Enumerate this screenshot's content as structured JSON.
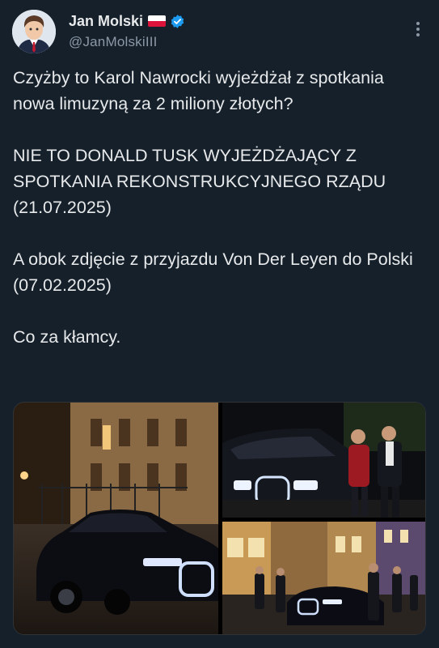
{
  "author": {
    "display_name": "Jan Molski",
    "handle": "@JanMolskiIII",
    "flag_icon": "poland-flag-icon",
    "verified_icon": "verified-badge-icon",
    "badge_color": "#1d9bf0"
  },
  "tweet": {
    "paragraphs": [
      "Czyżby to Karol Nawrocki wyjeżdżał z spotkania nowa limuzyną za 2 miliony złotych?",
      "NIE TO DONALD TUSK WYJEŻDŻAJĄCY Z SPOTKANIA REKONSTRUKCYJNEGO RZĄDU (21.07.2025)",
      "A obok zdjęcie z przyjazdu Von Der Leyen do Polski (07.02.2025)",
      "Co za kłamcy."
    ]
  },
  "colors": {
    "background": "#15202b",
    "text": "#e7e9ea",
    "secondary": "#8b98a5"
  }
}
